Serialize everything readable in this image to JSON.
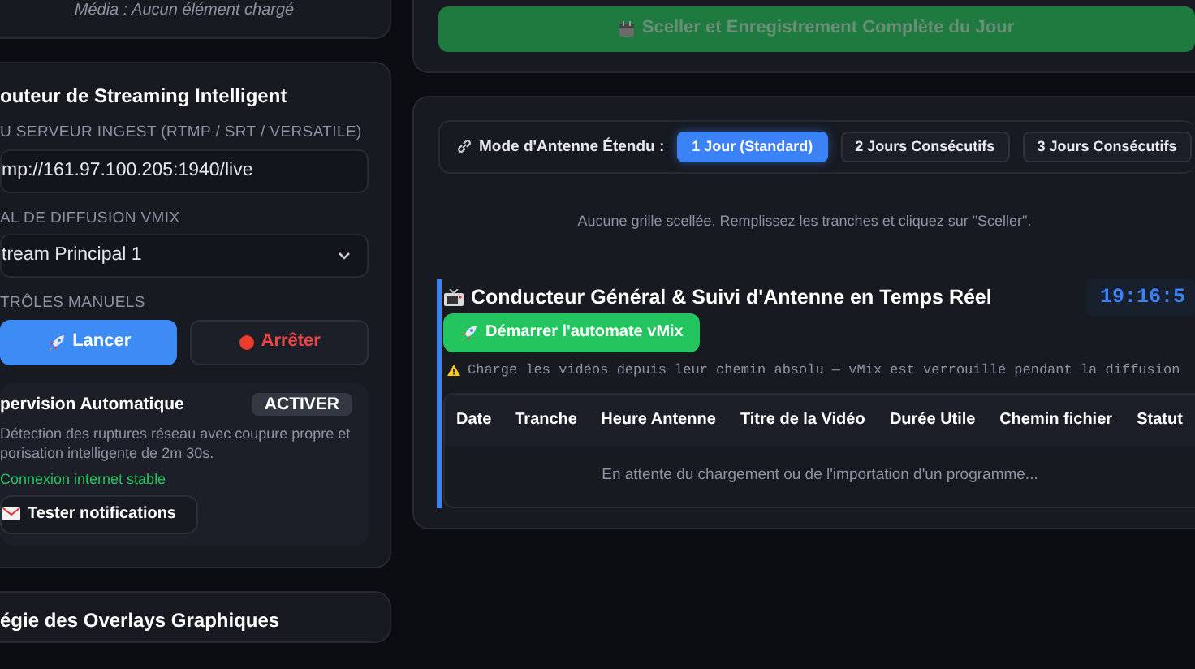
{
  "media_panel": {
    "status": "Média : Aucun élément chargé"
  },
  "stream_router": {
    "title": "outeur de Streaming Intelligent",
    "ingest": {
      "label": "U SERVEUR INGEST (RTMP / SRT / VERSATILE)",
      "value": "mp://161.97.100.205:1940/live"
    },
    "channel": {
      "label": "AL DE DIFFUSION VMIX",
      "value": "tream Principal 1"
    },
    "manual_controls": {
      "label": "TRÔLES MANUELS",
      "buttons": [
        {
          "kind": "start",
          "label": "Lancer"
        },
        {
          "kind": "stop",
          "label": "Arrêter"
        }
      ]
    },
    "supervision": {
      "title": "pervision Automatique",
      "toggle_label": "ACTIVER",
      "description_lines": [
        "Détection des ruptures réseau avec coupure propre et",
        "porisation intelligente de 2m 30s."
      ],
      "status": "Connexion internet stable",
      "test_button": "Tester notifications"
    }
  },
  "overlays": {
    "title": "égie des Overlays Graphiques"
  },
  "seal_button": {
    "label": "Sceller et Enregistrement Complète du Jour",
    "disabled": true
  },
  "antenna_mode": {
    "label": "Mode d'Antenne Étendu :",
    "options": [
      {
        "label": "1 Jour (Standard)",
        "selected": true
      },
      {
        "label": "2 Jours Consécutifs",
        "selected": false
      },
      {
        "label": "3 Jours Consécutifs",
        "selected": false
      }
    ]
  },
  "grid_message": "Aucune grille scellée. Remplissez les tranches et cliquez sur \"Sceller\".",
  "rundown": {
    "title": "Conducteur Général & Suivi d'Antenne en Temps Réel",
    "clock": "19:16:5",
    "start_button": "Démarrer l'automate vMix",
    "warning": "Charge les vidéos depuis leur chemin absolu — vMix est verrouillé pendant la diffusion",
    "table": {
      "columns": [
        "Date",
        "Tranche",
        "Heure Antenne",
        "Titre de la Vidéo",
        "Durée Utile",
        "Chemin fichier",
        "Statut"
      ],
      "empty_message": "En attente du chargement ou de l'importation d'un programme..."
    }
  }
}
